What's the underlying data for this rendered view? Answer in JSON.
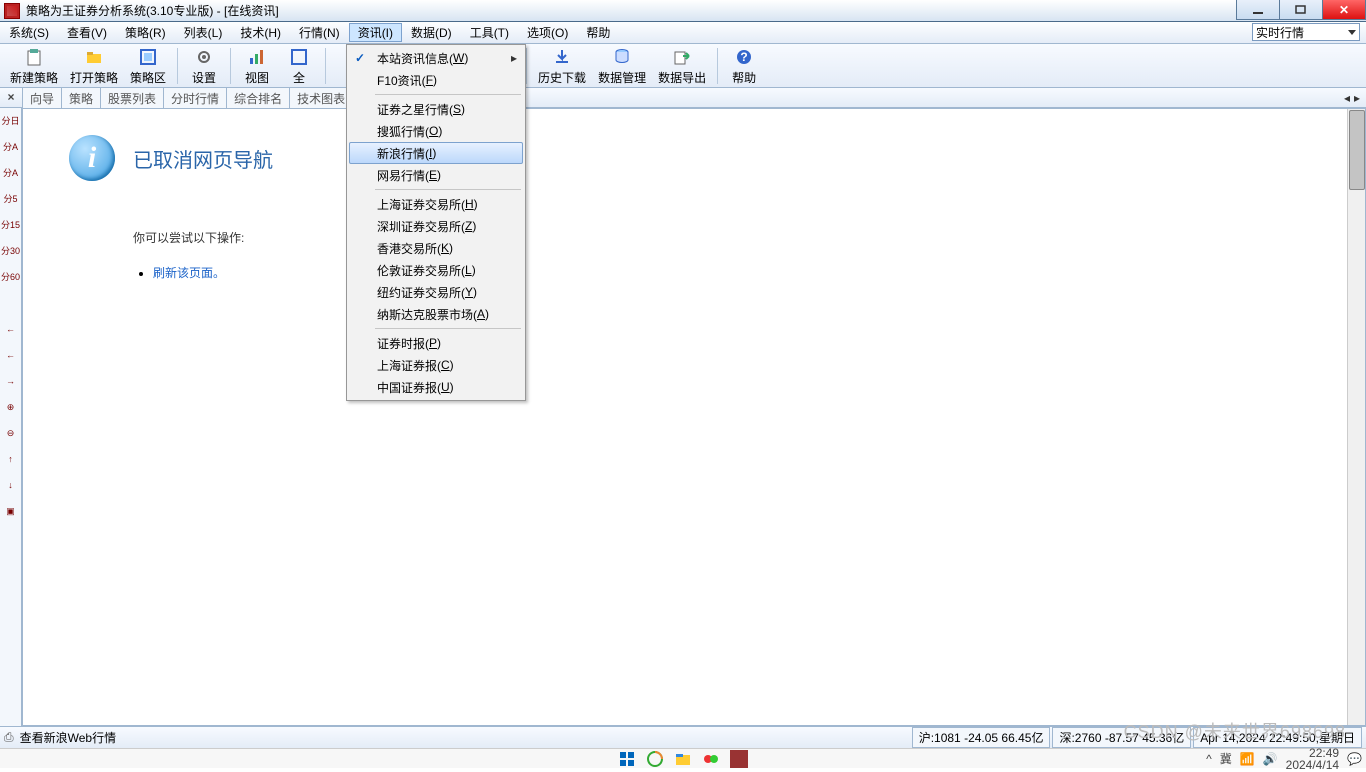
{
  "title": "策略为王证券分析系统(3.10专业版) - [在线资讯]",
  "menubar": {
    "items": [
      {
        "label": "系统(S)"
      },
      {
        "label": "查看(V)"
      },
      {
        "label": "策略(R)"
      },
      {
        "label": "列表(L)"
      },
      {
        "label": "技术(H)"
      },
      {
        "label": "行情(N)"
      },
      {
        "label": "资讯(I)",
        "active": true
      },
      {
        "label": "数据(D)"
      },
      {
        "label": "工具(T)"
      },
      {
        "label": "选项(O)"
      },
      {
        "label": "帮助"
      }
    ],
    "realtime_label": "实时行情"
  },
  "toolbar": {
    "items": [
      {
        "label": "新建策略",
        "icon": "new"
      },
      {
        "label": "打开策略",
        "icon": "open"
      },
      {
        "label": "策略区",
        "icon": "zone"
      },
      {
        "sep": true
      },
      {
        "label": "设置",
        "icon": "gear"
      },
      {
        "sep": true
      },
      {
        "label": "视图",
        "icon": "chart"
      },
      {
        "label": "全",
        "icon": "full"
      },
      {
        "sep": true
      },
      {
        "gap": 190
      },
      {
        "sep": true
      },
      {
        "label": "历史下载",
        "icon": "dl"
      },
      {
        "label": "数据管理",
        "icon": "db"
      },
      {
        "label": "数据导出",
        "icon": "export"
      },
      {
        "sep": true
      },
      {
        "label": "帮助",
        "icon": "help"
      }
    ]
  },
  "doc_tabs": [
    {
      "label": "向导"
    },
    {
      "label": "策略"
    },
    {
      "label": "股票列表"
    },
    {
      "label": "分时行情"
    },
    {
      "label": "综合排名"
    },
    {
      "label": "技术图表"
    }
  ],
  "dropdown": {
    "items": [
      {
        "label": "本站资讯信息",
        "hot": "W",
        "checked": true,
        "submenu": true
      },
      {
        "label": "F10资讯",
        "hot": "F"
      },
      {
        "sep": true
      },
      {
        "label": "证券之星行情",
        "hot": "S"
      },
      {
        "label": "搜狐行情",
        "hot": "O"
      },
      {
        "label": "新浪行情",
        "hot": "I",
        "hover": true
      },
      {
        "label": "网易行情",
        "hot": "E"
      },
      {
        "sep": true
      },
      {
        "label": "上海证券交易所",
        "hot": "H"
      },
      {
        "label": "深圳证券交易所",
        "hot": "Z"
      },
      {
        "label": "香港交易所",
        "hot": "K"
      },
      {
        "label": "伦敦证券交易所",
        "hot": "L"
      },
      {
        "label": "纽约证券交易所",
        "hot": "Y"
      },
      {
        "label": "纳斯达克股票市场",
        "hot": "A"
      },
      {
        "sep": true
      },
      {
        "label": "证券时报",
        "hot": "P"
      },
      {
        "label": "上海证券报",
        "hot": "C"
      },
      {
        "label": "中国证券报",
        "hot": "U"
      }
    ]
  },
  "content": {
    "heading": "已取消网页导航",
    "subtext": "你可以尝试以下操作:",
    "link": "刷新该页面。"
  },
  "leftbar": [
    "分日",
    "分A",
    "分A",
    "分5",
    "分15",
    "分30",
    "分60",
    "",
    "←",
    "←",
    "→",
    "⊕",
    "⊖",
    "↑",
    "↓",
    "▣"
  ],
  "statusbar": {
    "text": "查看新浪Web行情",
    "panels": [
      "沪:1081 -24.05 66.45亿",
      "深:2760 -87.57 45.36亿",
      "Apr 14,2024 22:49:50,星期日"
    ]
  },
  "taskbar": {
    "tray_text": "冀",
    "time": "22:49",
    "date": "2024/4/14",
    "watermark": "CSDN @未来世界698698"
  }
}
